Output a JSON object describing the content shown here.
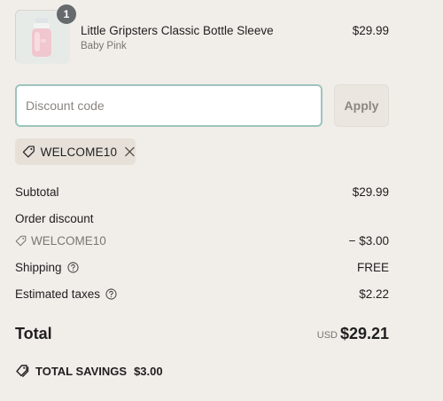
{
  "line_item": {
    "quantity": "1",
    "title": "Little Gripsters Classic Bottle Sleeve",
    "variant": "Baby Pink",
    "price": "$29.99"
  },
  "discount": {
    "placeholder": "Discount code",
    "apply_label": "Apply",
    "applied_code": "WELCOME10"
  },
  "totals": {
    "subtotal_label": "Subtotal",
    "subtotal_value": "$29.99",
    "order_discount_label": "Order discount",
    "order_discount_code": "WELCOME10",
    "order_discount_value": "− $3.00",
    "shipping_label": "Shipping",
    "shipping_value": "FREE",
    "taxes_label": "Estimated taxes",
    "taxes_value": "$2.22",
    "total_label": "Total",
    "currency": "USD",
    "total_value": "$29.21",
    "savings_label": "TOTAL SAVINGS",
    "savings_value": "$3.00"
  },
  "icons": {
    "tag": "tag-icon",
    "remove": "close-icon",
    "help": "question-circle-icon",
    "savings": "tags-icon"
  },
  "colors": {
    "page_bg": "#f1ede9",
    "input_focus_border": "#9cc5bd",
    "chip_bg": "#e6e0d9",
    "badge_bg": "#666a6d"
  }
}
